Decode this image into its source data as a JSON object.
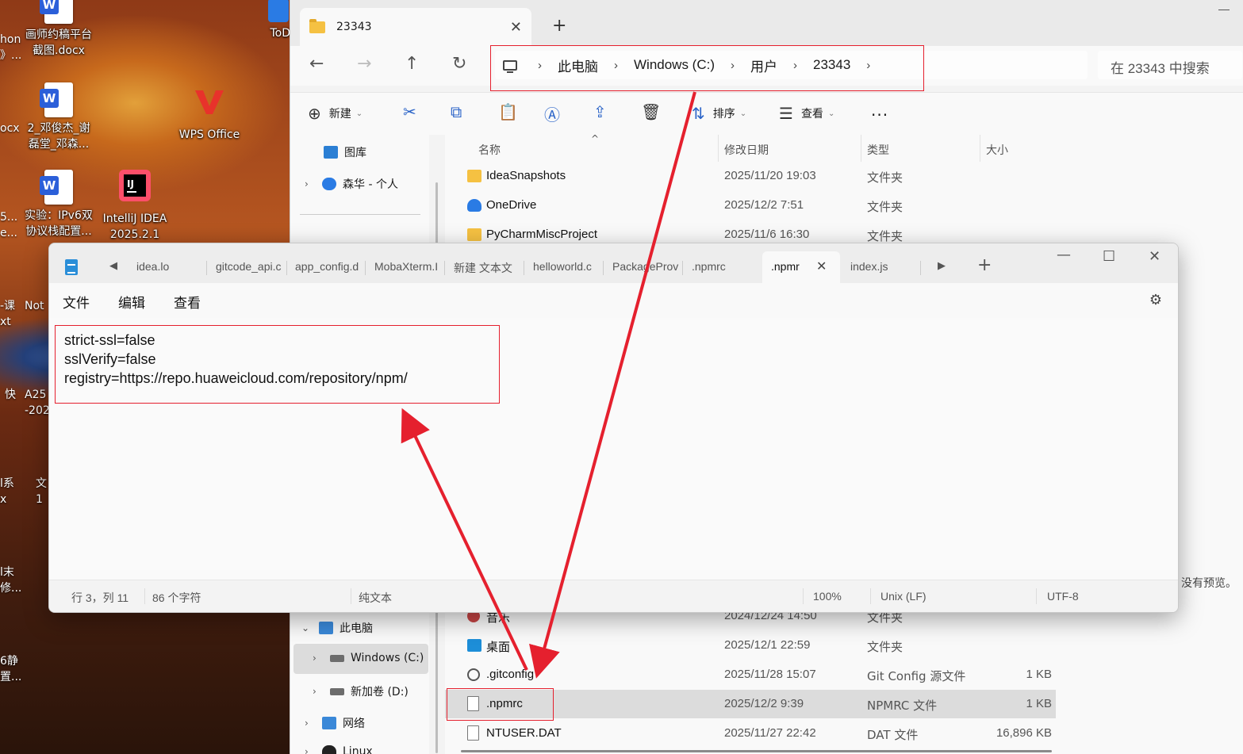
{
  "desktop": {
    "icons": [
      {
        "label": "画师约稿平台\n截图.docx",
        "type": "word"
      },
      {
        "label": "2_邓俊杰_谢\n磊堂_邓森...",
        "type": "word"
      },
      {
        "label": "实验：IPv6双\n协议栈配置...",
        "type": "word"
      },
      {
        "label": "WPS Office",
        "type": "wps"
      },
      {
        "label": "IntelliJ IDEA\n2025.2.1",
        "type": "idea"
      },
      {
        "label": "ToD",
        "type": "todo"
      }
    ],
    "partial_labels": [
      "hon\n》...",
      "ocx",
      "5...\ne...",
      "-课\nxt",
      "Not",
      "快\n",
      "A25\n-202",
      "l系\nx",
      "文\n1",
      "l末\n修...",
      "6静\n置..."
    ]
  },
  "explorer": {
    "tab_title": "23343",
    "breadcrumbs": [
      "此电脑",
      "Windows (C:)",
      "用户",
      "23343"
    ],
    "search_placeholder": "在 23343 中搜索",
    "commands": {
      "new": "新建",
      "sort": "排序",
      "view": "查看",
      "more": "..."
    },
    "nav_pane": [
      {
        "label": "图库",
        "icon": "gallery-icon"
      },
      {
        "label": "森华 - 个人",
        "icon": "onedrive-icon"
      },
      {
        "label": "此电脑",
        "icon": "pc-icon"
      },
      {
        "label": "Windows (C:)",
        "icon": "drive-icon",
        "selected": true
      },
      {
        "label": "新加卷 (D:)",
        "icon": "drive-icon"
      },
      {
        "label": "网络",
        "icon": "network-icon"
      },
      {
        "label": "Linux",
        "icon": "linux-icon"
      }
    ],
    "columns": {
      "name": "名称",
      "modified": "修改日期",
      "type": "类型",
      "size": "大小"
    },
    "rows_top": [
      {
        "name": "IdeaSnapshots",
        "date": "2025/11/20 19:03",
        "type": "文件夹",
        "size": "",
        "icon": "folder"
      },
      {
        "name": "OneDrive",
        "date": "2025/12/2 7:51",
        "type": "文件夹",
        "size": "",
        "icon": "cloud"
      },
      {
        "name": "PyCharmMiscProject",
        "date": "2025/11/6 16:30",
        "type": "文件夹",
        "size": "",
        "icon": "folder"
      }
    ],
    "rows_bottom": [
      {
        "name": "音乐",
        "date": "2024/12/24 14:50",
        "type": "文件夹",
        "size": "",
        "icon": "music"
      },
      {
        "name": "桌面",
        "date": "2025/12/1 22:59",
        "type": "文件夹",
        "size": "",
        "icon": "desktop"
      },
      {
        "name": ".gitconfig",
        "date": "2025/11/28 15:07",
        "type": "Git Config 源文件",
        "size": "1 KB",
        "icon": "gear"
      },
      {
        "name": ".npmrc",
        "date": "2025/12/2 9:39",
        "type": "NPMRC 文件",
        "size": "1 KB",
        "icon": "file",
        "selected": true
      },
      {
        "name": "NTUSER.DAT",
        "date": "2025/11/27 22:42",
        "type": "DAT 文件",
        "size": "16,896 KB",
        "icon": "file"
      }
    ],
    "preview_text": "没有预览。"
  },
  "notepad": {
    "tabs": [
      "idea.lo",
      "gitcode_api.c",
      "app_config.d",
      "MobaXterm.I",
      "新建 文本文",
      "helloworld.c",
      "PackageProv",
      ".npmrc",
      ".npmr",
      "index.js"
    ],
    "active_tab": ".npmr",
    "menus": [
      "文件",
      "编辑",
      "查看"
    ],
    "content_lines": [
      "strict-ssl=false",
      "sslVerify=false",
      "registry=https://repo.huaweicloud.com/repository/npm/"
    ],
    "status": {
      "position": "行 3，列 11",
      "chars": "86 个字符",
      "format": "纯文本",
      "zoom": "100%",
      "eol": "Unix (LF)",
      "encoding": "UTF-8"
    }
  },
  "colors": {
    "annotation_red": "#e5202e",
    "accent_blue": "#2b64c8"
  }
}
